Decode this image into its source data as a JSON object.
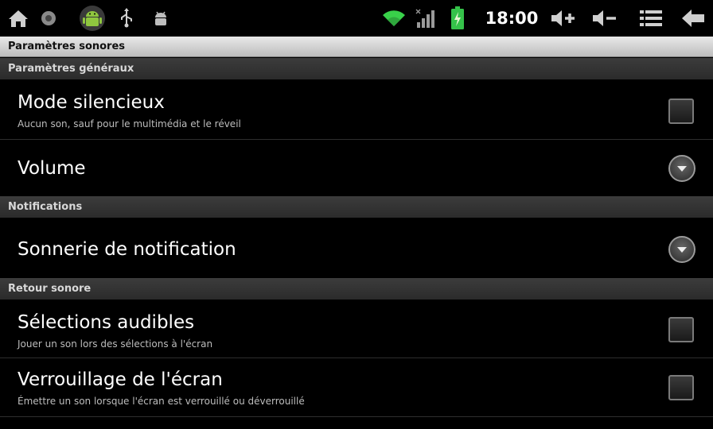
{
  "status_bar": {
    "time": "18:00",
    "left_icons": [
      "home-icon",
      "notification-dot-icon",
      "android-icon",
      "usb-icon",
      "debug-icon"
    ],
    "right_icons": [
      "wifi-icon",
      "signal-icon",
      "battery-charging-icon",
      "volume-up-icon",
      "volume-down-icon",
      "menu-icon",
      "back-icon"
    ]
  },
  "window": {
    "title": "Paramètres sonores"
  },
  "categories": [
    {
      "label": "Paramètres généraux",
      "items": [
        {
          "title": "Mode silencieux",
          "summary": "Aucun son, sauf pour le multimédia et le réveil",
          "widget": "checkbox",
          "checked": false
        },
        {
          "title": "Volume",
          "summary": "",
          "widget": "dropdown"
        }
      ]
    },
    {
      "label": "Notifications",
      "items": [
        {
          "title": "Sonnerie de notification",
          "summary": "",
          "widget": "dropdown"
        }
      ]
    },
    {
      "label": "Retour sonore",
      "items": [
        {
          "title": "Sélections audibles",
          "summary": "Jouer un son lors des sélections à l'écran",
          "widget": "checkbox",
          "checked": false
        },
        {
          "title": "Verrouillage de l'écran",
          "summary": "Émettre un son lorsque l'écran est verrouillé ou déverrouillé",
          "widget": "checkbox",
          "checked": false
        }
      ]
    }
  ],
  "colors": {
    "background": "#000000",
    "title_bar": "#d6d6d6",
    "category_header": "#333333",
    "wifi": "#39d14a",
    "battery": "#35c24a"
  }
}
